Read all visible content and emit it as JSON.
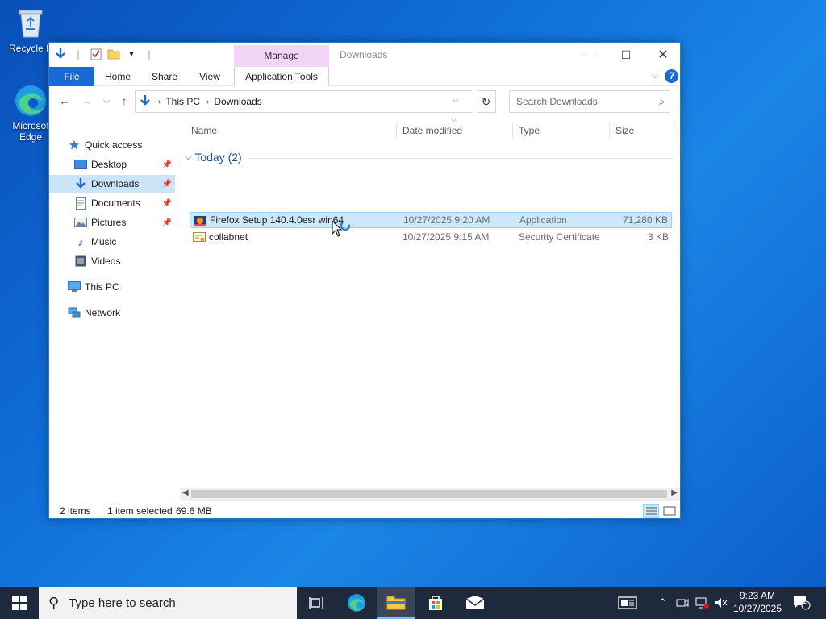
{
  "desktop": {
    "icons": [
      {
        "label": "Recycle Bin",
        "visible_label": "Recycle B"
      },
      {
        "label_line1": "Microsof",
        "label_line2": "Edge"
      }
    ]
  },
  "window": {
    "title": "Downloads",
    "context_tab": "Manage",
    "ribbon_tabs": {
      "file": "File",
      "home": "Home",
      "share": "Share",
      "view": "View",
      "app_tools": "Application Tools"
    },
    "address": {
      "path": [
        "This PC",
        "Downloads"
      ]
    },
    "search_placeholder": "Search Downloads",
    "nav_pane": {
      "quick_access": "Quick access",
      "items": [
        {
          "label": "Desktop",
          "pinned": true
        },
        {
          "label": "Downloads",
          "pinned": true,
          "selected": true
        },
        {
          "label": "Documents",
          "pinned": true
        },
        {
          "label": "Pictures",
          "pinned": true
        },
        {
          "label": "Music",
          "pinned": false
        },
        {
          "label": "Videos",
          "pinned": false
        }
      ],
      "this_pc": "This PC",
      "network": "Network"
    },
    "columns": {
      "name": "Name",
      "date": "Date modified",
      "type": "Type",
      "size": "Size"
    },
    "group": {
      "label": "Today (2)"
    },
    "files": [
      {
        "name": "Firefox Setup 140.4.0esr win64",
        "date": "10/27/2025 9:20 AM",
        "type": "Application",
        "size": "71,280 KB",
        "selected": true
      },
      {
        "name": "collabnet",
        "date": "10/27/2025 9:15 AM",
        "type": "Security Certificate",
        "size": "3 KB",
        "selected": false
      }
    ],
    "status": {
      "count": "2 items",
      "selection": "1 item selected",
      "size": "69.6 MB"
    }
  },
  "taskbar": {
    "search_placeholder": "Type here to search",
    "clock_time": "9:23 AM",
    "clock_date": "10/27/2025",
    "notification_count": "1"
  },
  "colors": {
    "accent": "#1a6ad6",
    "selection": "#cce8ff",
    "manage_tab": "#f2d6f6",
    "taskbar": "#1e2a3b"
  }
}
